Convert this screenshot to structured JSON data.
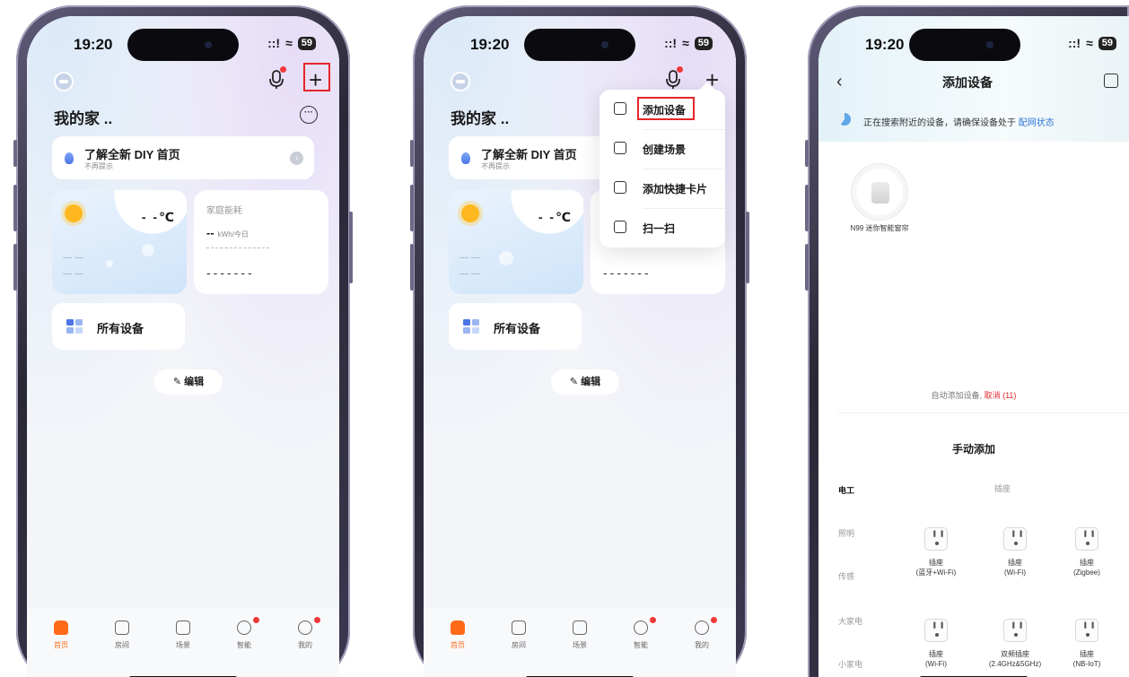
{
  "status": {
    "time": "19:20",
    "signal": "::!",
    "wifi": "≈",
    "battery": "59"
  },
  "screen1": {
    "home_name": "我的家 ..",
    "more_icon": "ellipsis-circle-icon",
    "banner": {
      "title": "了解全新 DIY 首页",
      "subtitle": "不再提示"
    },
    "weather": {
      "temp": "- -℃",
      "dash1": "— —",
      "dash2": "— —"
    },
    "energy": {
      "label": "家庭能耗",
      "value": "--",
      "unit": "kWh/今日",
      "dashes": "-------"
    },
    "all_devices": "所有设备",
    "edit": "✎ 编辑",
    "add_icon": "+",
    "highlight_color": "#e5262b"
  },
  "tabs": [
    {
      "label": "首页",
      "icon": "home-icon"
    },
    {
      "label": "房间",
      "icon": "room-icon"
    },
    {
      "label": "场景",
      "icon": "scene-icon"
    },
    {
      "label": "智能",
      "icon": "smart-icon"
    },
    {
      "label": "我的",
      "icon": "profile-icon"
    }
  ],
  "menu": {
    "items": [
      {
        "label": "添加设备",
        "icon": "add-device-icon"
      },
      {
        "label": "创建场景",
        "icon": "create-scene-icon"
      },
      {
        "label": "添加快捷卡片",
        "icon": "add-card-icon"
      },
      {
        "label": "扫一扫",
        "icon": "scan-icon"
      }
    ]
  },
  "screen3": {
    "title": "添加设备",
    "back": "‹",
    "searching_prefix": "正在搜索附近的设备，请确保设备处于",
    "searching_link": "配网状态",
    "found_device": "N99 迷你智能窗帘",
    "auto_add_prefix": "自动添加设备,",
    "auto_add_cancel": "取消 (11)",
    "manual_title": "手动添加",
    "categories": [
      "电工",
      "照明",
      "传感",
      "大家电",
      "小家电"
    ],
    "subhead": "插座",
    "plugs_row1": [
      {
        "name": "插座",
        "sub": "(蓝牙+Wi-Fi)"
      },
      {
        "name": "插座",
        "sub": "(Wi-Fi)"
      },
      {
        "name": "插座",
        "sub": "(Zigbee)"
      }
    ],
    "plugs_row2": [
      {
        "name": "插座",
        "sub": "(Wi-Fi)"
      },
      {
        "name": "双频插座",
        "sub": "(2.4GHz&5GHz)"
      },
      {
        "name": "插座",
        "sub": "(NB-IoT)"
      }
    ]
  }
}
